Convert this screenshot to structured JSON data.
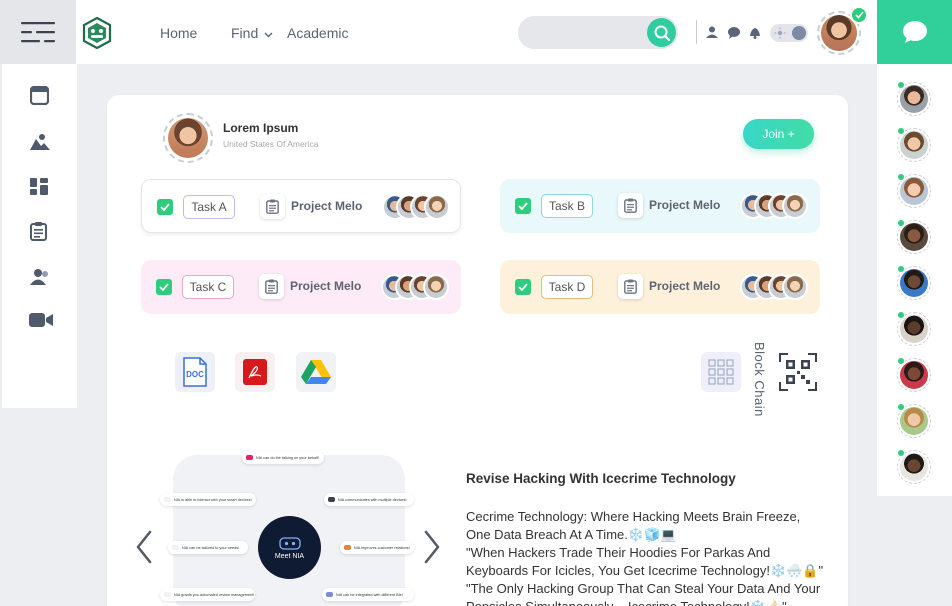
{
  "nav": {
    "home": "Home",
    "find": "Find",
    "academic": "Academic"
  },
  "profile": {
    "name": "Lorem Ipsum",
    "location": "United States Of America"
  },
  "join_label": "Join +",
  "tasks": [
    {
      "label": "Task A",
      "project": "Project Melo",
      "bg": "#ffffff",
      "pill_border": "#c9b6e8"
    },
    {
      "label": "Task B",
      "project": "Project Melo",
      "bg": "#e9f8fa",
      "pill_border": "#8fd6e3"
    },
    {
      "label": "Task C",
      "project": "Project Melo",
      "bg": "#fdecf7",
      "pill_border": "#e9a4cf"
    },
    {
      "label": "Task D",
      "project": "Project Melo",
      "bg": "#fdf1dc",
      "pill_border": "#e8bd7a"
    }
  ],
  "files": {
    "doc_label": "DOC"
  },
  "blockchain_label": "Block Chain",
  "mindmap": {
    "center_label": "Meet NIA",
    "nodes": [
      "NIA can do the talking on your behalf!",
      "NIA is able to interact with your smart devices!",
      "NIA communicates with multiple devices!",
      "NIA can be tailored to your needs!",
      "NIA improves customer relations!",
      "NIA grants you automated review management!",
      "NIA can be integrated with different BIs!"
    ]
  },
  "article": {
    "title": "Revise Hacking With Icecrime Technology",
    "lines": [
      "Cecrime Technology: Where Hacking Meets Brain Freeze, One Data Breach At A Time.❄️🧊💻",
      "\"When Hackers Trade Their Hoodies For Parkas And Keyboards For Icicles, You Get Icecrime Technology!❄️🌨️🔒\"",
      "\"The Only Hacking Group That Can Steal Your Data And Your Popsicles Simultaneously – Icecrime Technology!❄️🍦\""
    ]
  },
  "colors": {
    "accent": "#31cf9a",
    "online": "#2ecd7e",
    "dark": "#0f1a33"
  },
  "icons": [
    "menu-icon",
    "logo-icon",
    "search-icon",
    "user-icon",
    "chat-bubble-icon",
    "bell-icon",
    "sun-icon",
    "check-icon",
    "window-icon",
    "landscape-icon",
    "dashboard-icon",
    "clipboard-icon",
    "users-icon",
    "video-icon",
    "doc-file-icon",
    "pdf-icon",
    "drive-icon",
    "blockchain-icon",
    "qr-code-icon",
    "chevron-left-icon",
    "chevron-right-icon"
  ]
}
